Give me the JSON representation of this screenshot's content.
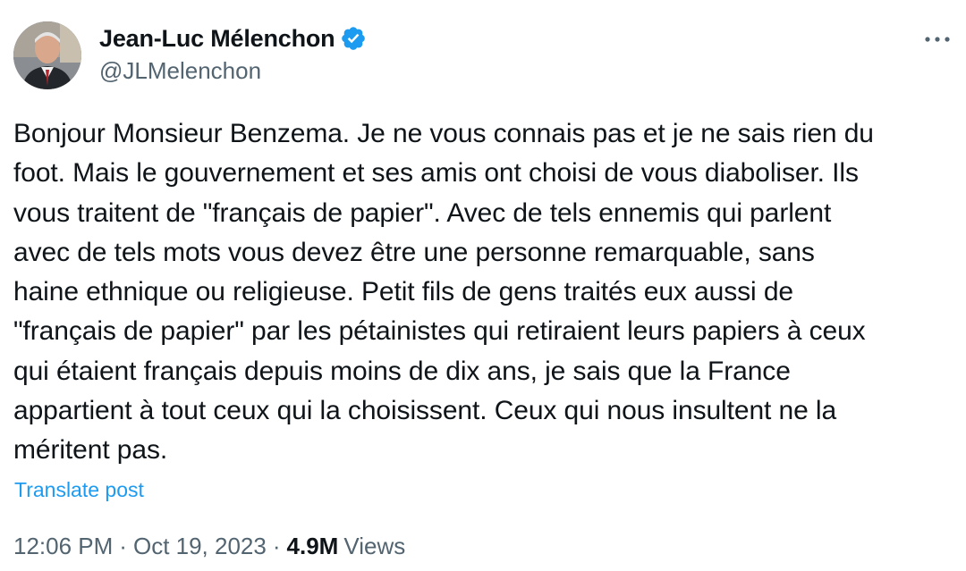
{
  "author": {
    "display_name": "Jean-Luc Mélenchon",
    "handle": "@JLMelenchon",
    "verified_icon": "verified-badge-icon",
    "avatar_icon": "avatar"
  },
  "more_icon": "more-horizontal-icon",
  "tweet": {
    "lines": [
      "Bonjour Monsieur Benzema. Je ne vous connais pas et je ne sais rien du",
      "foot. Mais le gouvernement et ses amis ont choisi de vous diaboliser. Ils",
      "vous traitent de \"français de papier\". Avec de tels ennemis qui parlent",
      "avec de tels mots vous devez être une personne remarquable, sans",
      "haine ethnique ou religieuse. Petit fils de gens traités eux aussi de",
      "\"français de papier\" par les pétainistes qui retiraient leurs papiers à ceux",
      "qui étaient français depuis moins de dix ans, je sais que la France",
      "appartient à tout ceux qui la choisissent. Ceux qui nous insultent ne la",
      "méritent pas."
    ],
    "translate_label": "Translate post"
  },
  "meta": {
    "time": "12:06 PM",
    "separator": "·",
    "date": "Oct 19, 2023",
    "views_count": "4.9M",
    "views_label": "Views"
  },
  "colors": {
    "text_primary": "#0f1419",
    "text_secondary": "#536471",
    "link": "#1d9bf0",
    "verified": "#1d9bf0"
  }
}
